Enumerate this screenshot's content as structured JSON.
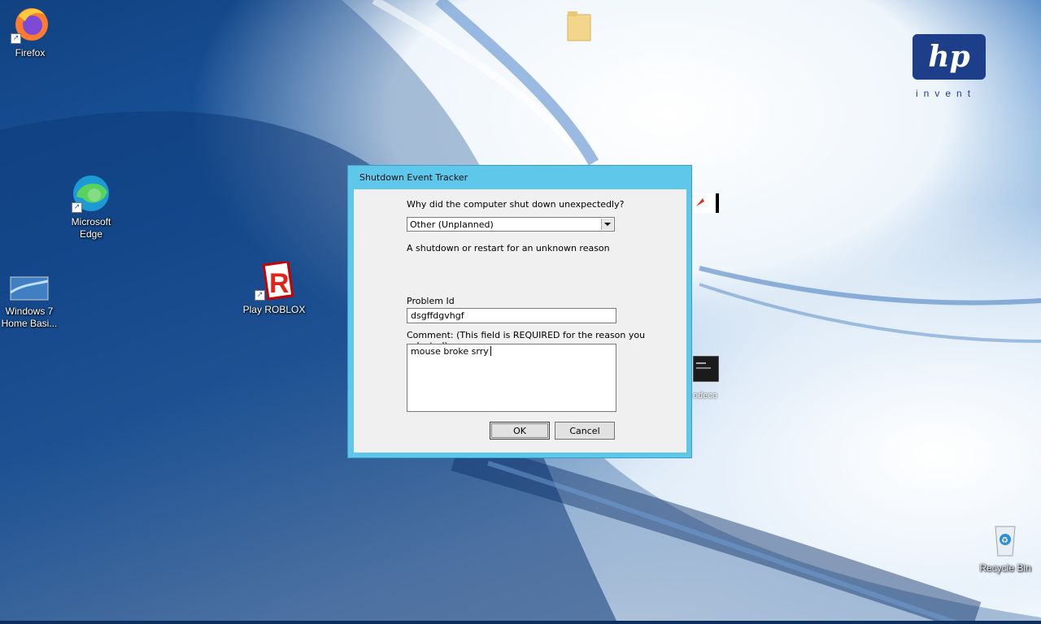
{
  "desktop": {
    "icons": [
      {
        "label": "Firefox"
      },
      {
        "label": "Microsoft Edge"
      },
      {
        "label": "Windows 7 Home Basi..."
      },
      {
        "label": "Play ROBLOX"
      },
      {
        "label": "odeco"
      },
      {
        "label": "Recycle Bin"
      }
    ]
  },
  "logo": {
    "mark": "hp",
    "tagline": "invent"
  },
  "dialog": {
    "title": "Shutdown Event Tracker",
    "question": "Why did the computer shut down unexpectedly?",
    "reason_selected": "Other (Unplanned)",
    "reason_description": "A shutdown or restart for an unknown reason",
    "problem_id_label": "Problem Id",
    "problem_id_value": "dsgffdgvhgf",
    "comment_label": "Comment: (This field is REQUIRED for the reason you selected)",
    "comment_value": "mouse broke srry",
    "ok_label": "OK",
    "cancel_label": "Cancel"
  },
  "colors": {
    "dialog_frame": "#5fc8ea",
    "hp_blue": "#1d3f8a"
  }
}
